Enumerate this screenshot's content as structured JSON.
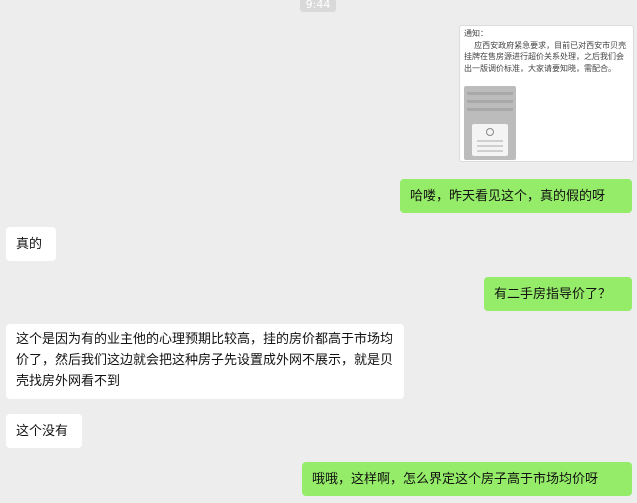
{
  "chat": {
    "timestamp": "9:44",
    "image_message": {
      "notice_text": "通知：\n    应西安政府紧急要求，目前已对西安市贝壳挂牌在售房源进行超价关系处理，之后我们会出一版调价标准，大家请要知晓，需配合。",
      "icon": "screenshot-thumbnail"
    },
    "messages": [
      {
        "side": "out",
        "text": "哈喽，昨天看见这个，真的假的呀"
      },
      {
        "side": "in",
        "text": "真的"
      },
      {
        "side": "out",
        "text": "有二手房指导价了？"
      },
      {
        "side": "in",
        "text": "这个是因为有的业主他的心理预期比较高，挂的房价都高于市场均价了，然后我们这边就会把这种房子先设置成外网不展示，就是贝壳找房外网看不到"
      },
      {
        "side": "in",
        "text": "这个没有"
      },
      {
        "side": "out",
        "text": "哦哦，这样啊，怎么界定这个房子高于市场均价呀"
      }
    ]
  }
}
